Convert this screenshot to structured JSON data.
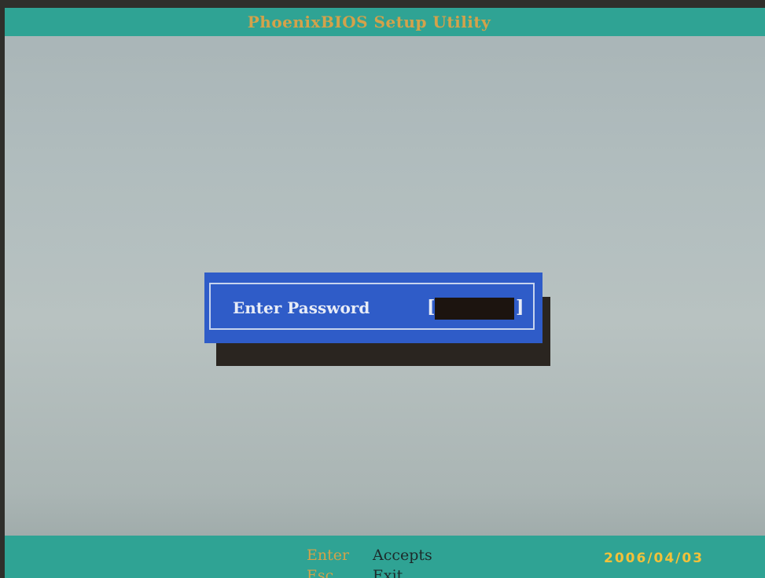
{
  "header": {
    "title": "PhoenixBIOS Setup Utility"
  },
  "dialog": {
    "label": "Enter Password",
    "bracket_open": "[",
    "bracket_close": "]",
    "password_value": ""
  },
  "footer": {
    "keys": [
      {
        "key": "Enter",
        "action": "Accepts"
      },
      {
        "key": "Esc",
        "action": "Exit"
      }
    ]
  },
  "photo_timestamp": "2006/04/03",
  "colors": {
    "title_bar": "#2fa394",
    "title_text": "#d4a24a",
    "screen_background": "#b1bdbe",
    "dialog_background": "#2f5cc8",
    "dialog_text": "#e8ecf6",
    "password_field": "#1c140f",
    "key_text": "#d4a24a",
    "timestamp": "#f3c13a"
  }
}
